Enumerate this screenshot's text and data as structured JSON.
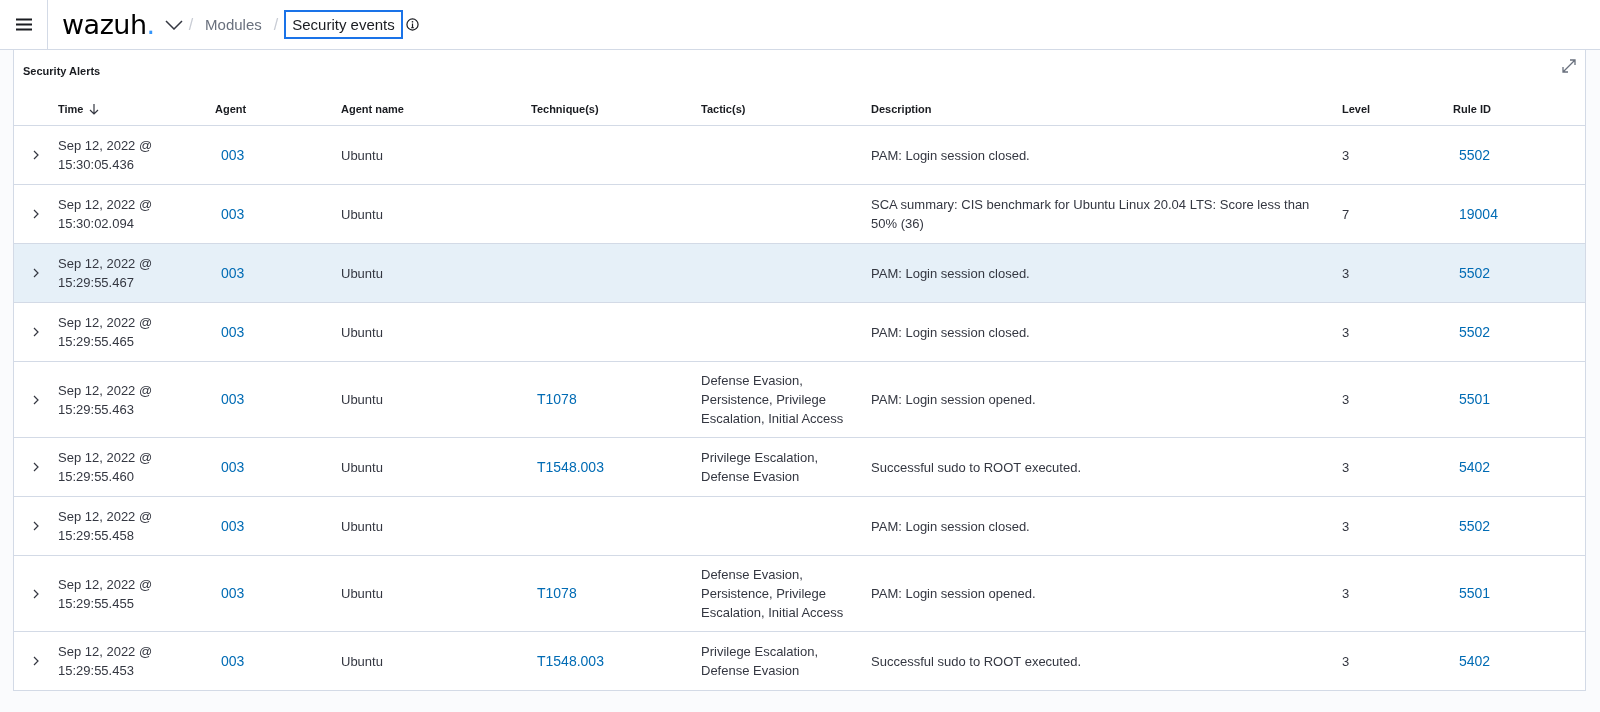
{
  "topbar": {
    "logo": "wazuh",
    "logo_dot": ".",
    "separator": "/",
    "breadcrumb": [
      {
        "label": "Modules",
        "selected": false
      },
      {
        "label": "Security events",
        "selected": true
      }
    ]
  },
  "panel": {
    "title": "Security Alerts"
  },
  "table": {
    "columns": [
      {
        "label": "Time",
        "sorted": true
      },
      {
        "label": "Agent",
        "sorted": false
      },
      {
        "label": "Agent name",
        "sorted": false
      },
      {
        "label": "Technique(s)",
        "sorted": false
      },
      {
        "label": "Tactic(s)",
        "sorted": false
      },
      {
        "label": "Description",
        "sorted": false
      },
      {
        "label": "Level",
        "sorted": false
      },
      {
        "label": "Rule ID",
        "sorted": false
      }
    ],
    "rows": [
      {
        "selected": false,
        "time": [
          "Sep 12, 2022 @",
          "15:30:05.436"
        ],
        "agent": "003",
        "agent_name": "Ubuntu",
        "techniques": [],
        "tactics": "",
        "description": "PAM: Login session closed.",
        "level": "3",
        "rule_id": "5502"
      },
      {
        "selected": false,
        "time": [
          "Sep 12, 2022 @",
          "15:30:02.094"
        ],
        "agent": "003",
        "agent_name": "Ubuntu",
        "techniques": [],
        "tactics": "",
        "description": "SCA summary: CIS benchmark for Ubuntu Linux 20.04 LTS: Score less than 50% (36)",
        "level": "7",
        "rule_id": "19004"
      },
      {
        "selected": true,
        "time": [
          "Sep 12, 2022 @",
          "15:29:55.467"
        ],
        "agent": "003",
        "agent_name": "Ubuntu",
        "techniques": [],
        "tactics": "",
        "description": "PAM: Login session closed.",
        "level": "3",
        "rule_id": "5502"
      },
      {
        "selected": false,
        "time": [
          "Sep 12, 2022 @",
          "15:29:55.465"
        ],
        "agent": "003",
        "agent_name": "Ubuntu",
        "techniques": [],
        "tactics": "",
        "description": "PAM: Login session closed.",
        "level": "3",
        "rule_id": "5502"
      },
      {
        "selected": false,
        "time": [
          "Sep 12, 2022 @",
          "15:29:55.463"
        ],
        "agent": "003",
        "agent_name": "Ubuntu",
        "techniques": [
          "T1078"
        ],
        "tactics": "Defense Evasion, Persistence, Privilege Escalation, Initial Access",
        "description": "PAM: Login session opened.",
        "level": "3",
        "rule_id": "5501"
      },
      {
        "selected": false,
        "time": [
          "Sep 12, 2022 @",
          "15:29:55.460"
        ],
        "agent": "003",
        "agent_name": "Ubuntu",
        "techniques": [
          "T1548.003"
        ],
        "tactics": "Privilege Escalation, Defense Evasion",
        "description": "Successful sudo to ROOT executed.",
        "level": "3",
        "rule_id": "5402"
      },
      {
        "selected": false,
        "time": [
          "Sep 12, 2022 @",
          "15:29:55.458"
        ],
        "agent": "003",
        "agent_name": "Ubuntu",
        "techniques": [],
        "tactics": "",
        "description": "PAM: Login session closed.",
        "level": "3",
        "rule_id": "5502"
      },
      {
        "selected": false,
        "time": [
          "Sep 12, 2022 @",
          "15:29:55.455"
        ],
        "agent": "003",
        "agent_name": "Ubuntu",
        "techniques": [
          "T1078"
        ],
        "tactics": "Defense Evasion, Persistence, Privilege Escalation, Initial Access",
        "description": "PAM: Login session opened.",
        "level": "3",
        "rule_id": "5501"
      },
      {
        "selected": false,
        "time": [
          "Sep 12, 2022 @",
          "15:29:55.453"
        ],
        "agent": "003",
        "agent_name": "Ubuntu",
        "techniques": [
          "T1548.003"
        ],
        "tactics": "Privilege Escalation, Defense Evasion",
        "description": "Successful sudo to ROOT executed.",
        "level": "3",
        "rule_id": "5402"
      }
    ]
  }
}
